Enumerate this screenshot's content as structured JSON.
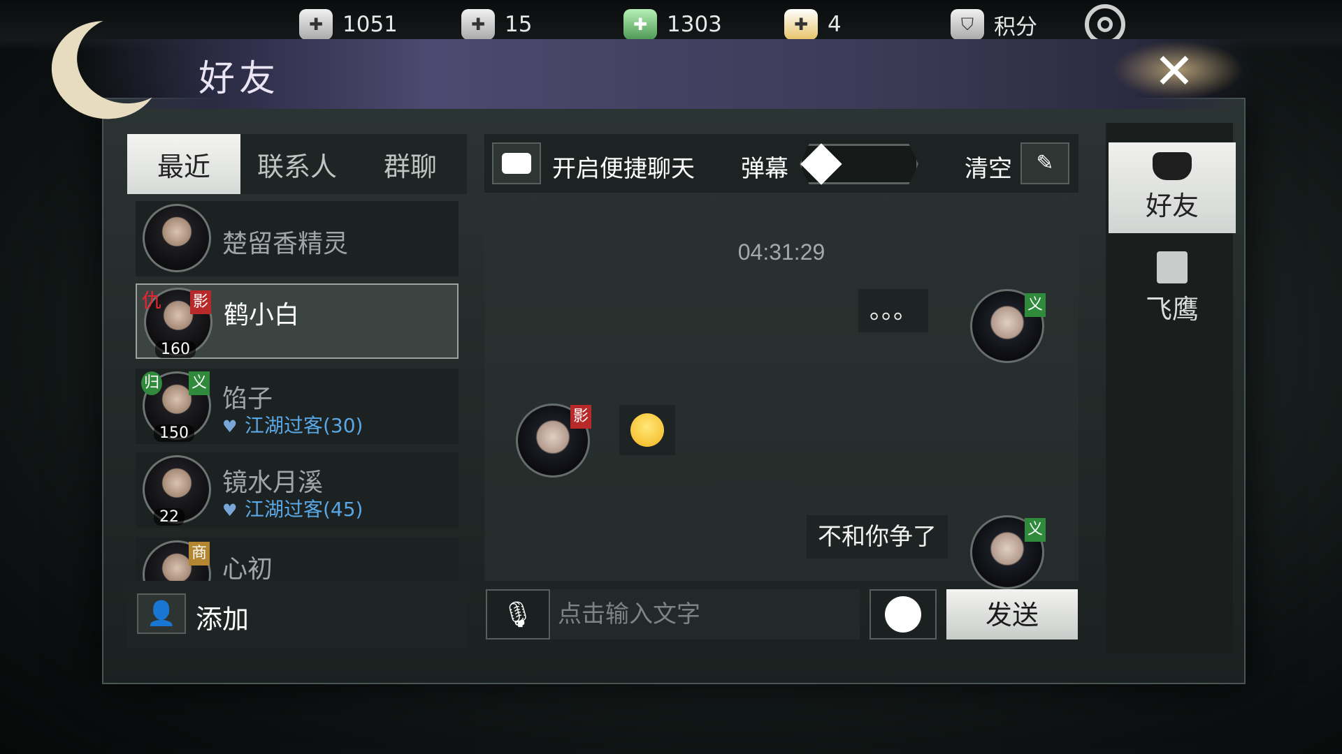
{
  "currencies": [
    {
      "icon": "coin-plus-icon",
      "value": "1051"
    },
    {
      "icon": "ingot-plus-icon",
      "value": "15"
    },
    {
      "icon": "jade-plus-icon",
      "value": "1303"
    },
    {
      "icon": "treasure-cup-icon",
      "value": "4"
    }
  ],
  "points_label": "积分",
  "window_title": "好友",
  "tabs": [
    "最近",
    "联系人",
    "群聊"
  ],
  "friends": [
    {
      "name": "楚留香精灵",
      "level": "",
      "sub": "",
      "badges": []
    },
    {
      "name": "鹤小白",
      "level": "160",
      "sub": "",
      "badges": [
        "仇",
        "影"
      ]
    },
    {
      "name": "馅子",
      "level": "150",
      "sub": "江湖过客(30)",
      "badges": [
        "归",
        "义"
      ]
    },
    {
      "name": "镜水月溪",
      "level": "22",
      "sub": "江湖过客(45)",
      "badges": []
    },
    {
      "name": "心初",
      "level": "",
      "sub": "",
      "badges": [
        "商"
      ]
    }
  ],
  "add_label": "添加",
  "chat": {
    "quick_chat_label": "开启便捷聊天",
    "danmu_label": "弹幕",
    "clear_label": "清空",
    "timestamp": "04:31:29",
    "messages": [
      {
        "side": "right",
        "text": "。。。",
        "badge": "义"
      },
      {
        "side": "left",
        "text": "",
        "emoji": "smile-emoji",
        "badge": "影"
      },
      {
        "side": "right",
        "text": "不和你争了",
        "badge": "义"
      }
    ],
    "input_placeholder": "点击输入文字",
    "send_label": "发送"
  },
  "side_tabs": [
    {
      "label": "好友",
      "icon": "teapot-icon",
      "active": true
    },
    {
      "label": "飞鹰",
      "icon": "scroll-icon",
      "active": false
    }
  ]
}
